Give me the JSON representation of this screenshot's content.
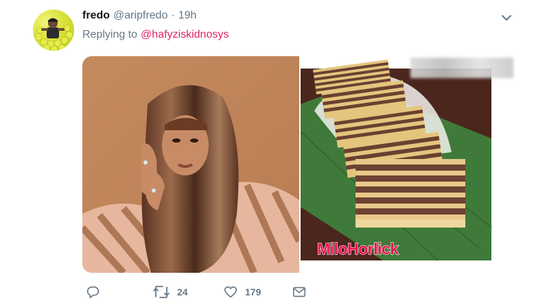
{
  "tweet": {
    "display_name": "fredo",
    "handle": "@aripfredo",
    "separator": "·",
    "time": "19h",
    "replying_prefix": "Replying to",
    "replying_to": "@hafyziskidnosys"
  },
  "media": {
    "right_watermark": "MiloHorlick"
  },
  "actions": {
    "reply_count": "",
    "retweet_count": "24",
    "like_count": "179"
  },
  "colors": {
    "link": "#e0245e",
    "muted": "#657786",
    "text": "#14171a"
  },
  "icons": [
    "chevron-down-icon",
    "reply-icon",
    "retweet-icon",
    "heart-icon",
    "envelope-icon"
  ]
}
